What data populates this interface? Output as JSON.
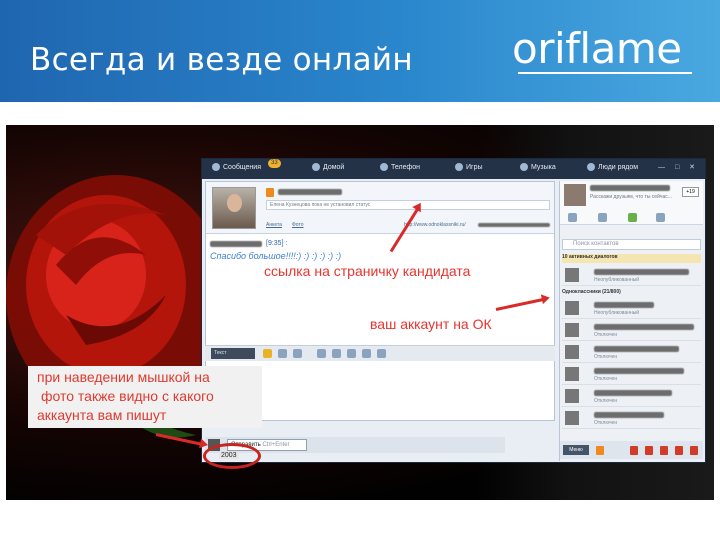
{
  "slide": {
    "title": "Всегда и везде онлайн",
    "brand": "oriflame"
  },
  "agent": {
    "tabs": [
      {
        "label": "Сообщения"
      },
      {
        "label": "Домой"
      },
      {
        "label": "Телефон"
      },
      {
        "label": "Игры"
      },
      {
        "label": "Музыка"
      },
      {
        "label": "Люди рядом"
      }
    ],
    "messages_badge": "33",
    "status_text": "Елена Кузнецова пока не установил статус",
    "profile_links": [
      "Анкета",
      "Фото"
    ],
    "url_text": "http://www.odnoklassniki.ru/",
    "message_time": "[9:35] :",
    "message_body": "Спасибо большое!!!!:) :) :) :) :) :)",
    "toolbar_send_mode": "Текст",
    "send_button": "Отправить",
    "send_hint": "Ctrl+Enter",
    "nick_tag": "2003"
  },
  "contacts": {
    "hint": "Расскажи друзьям, что ты сейчас...",
    "count": "+19",
    "search_placeholder": "Поиск контактов",
    "dialogs_label": "10 активных диалогов",
    "group_label": "Одноклассники (21/800)",
    "statuses": [
      "Неопубликованный",
      "Неопубликованный",
      "Отключен",
      "Отключен",
      "Отключен",
      "Отключен",
      "Отключен",
      "Отключен"
    ],
    "menu": "Меню"
  },
  "annotations": {
    "candidate_link": "ссылка на страничку кандидата",
    "ok_account": "ваш аккаунт на ОК",
    "hover_note": [
      "при наведении мышкой на",
      "фото также видно с какого",
      "аккаунта вам пишут"
    ]
  }
}
